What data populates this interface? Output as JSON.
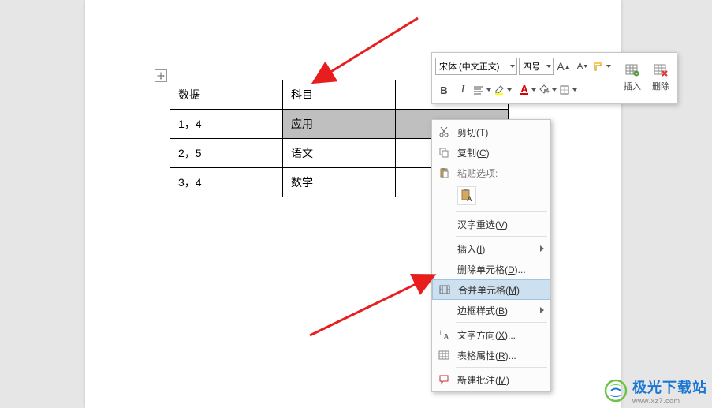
{
  "table": {
    "rows": [
      [
        "数据",
        "科目",
        ""
      ],
      [
        "1，4",
        "应用",
        ""
      ],
      [
        "2，5",
        "语文",
        ""
      ],
      [
        "3，4",
        "数学",
        ""
      ]
    ],
    "selected_row": 1,
    "selected_cols": [
      1,
      2
    ]
  },
  "mini_toolbar": {
    "font_name": "宋体 (中文正文)",
    "font_size": "四号",
    "buttons": {
      "increase_font": "A",
      "decrease_font": "A",
      "bold": "B",
      "italic": "I",
      "insert_label": "插入",
      "delete_label": "删除"
    }
  },
  "context_menu": {
    "cut": "剪切(T)",
    "copy": "复制(C)",
    "paste_header": "粘贴选项:",
    "hanzi_reselect": "汉字重选(V)",
    "insert": "插入(I)",
    "delete_cells": "删除单元格(D)...",
    "merge_cells": "合并单元格(M)",
    "border_style": "边框样式(B)",
    "text_direction": "文字方向(X)...",
    "table_properties": "表格属性(R)...",
    "new_comment": "新建批注(M)"
  },
  "watermark": {
    "cn": "极光下载站",
    "url": "www.xz7.com"
  }
}
